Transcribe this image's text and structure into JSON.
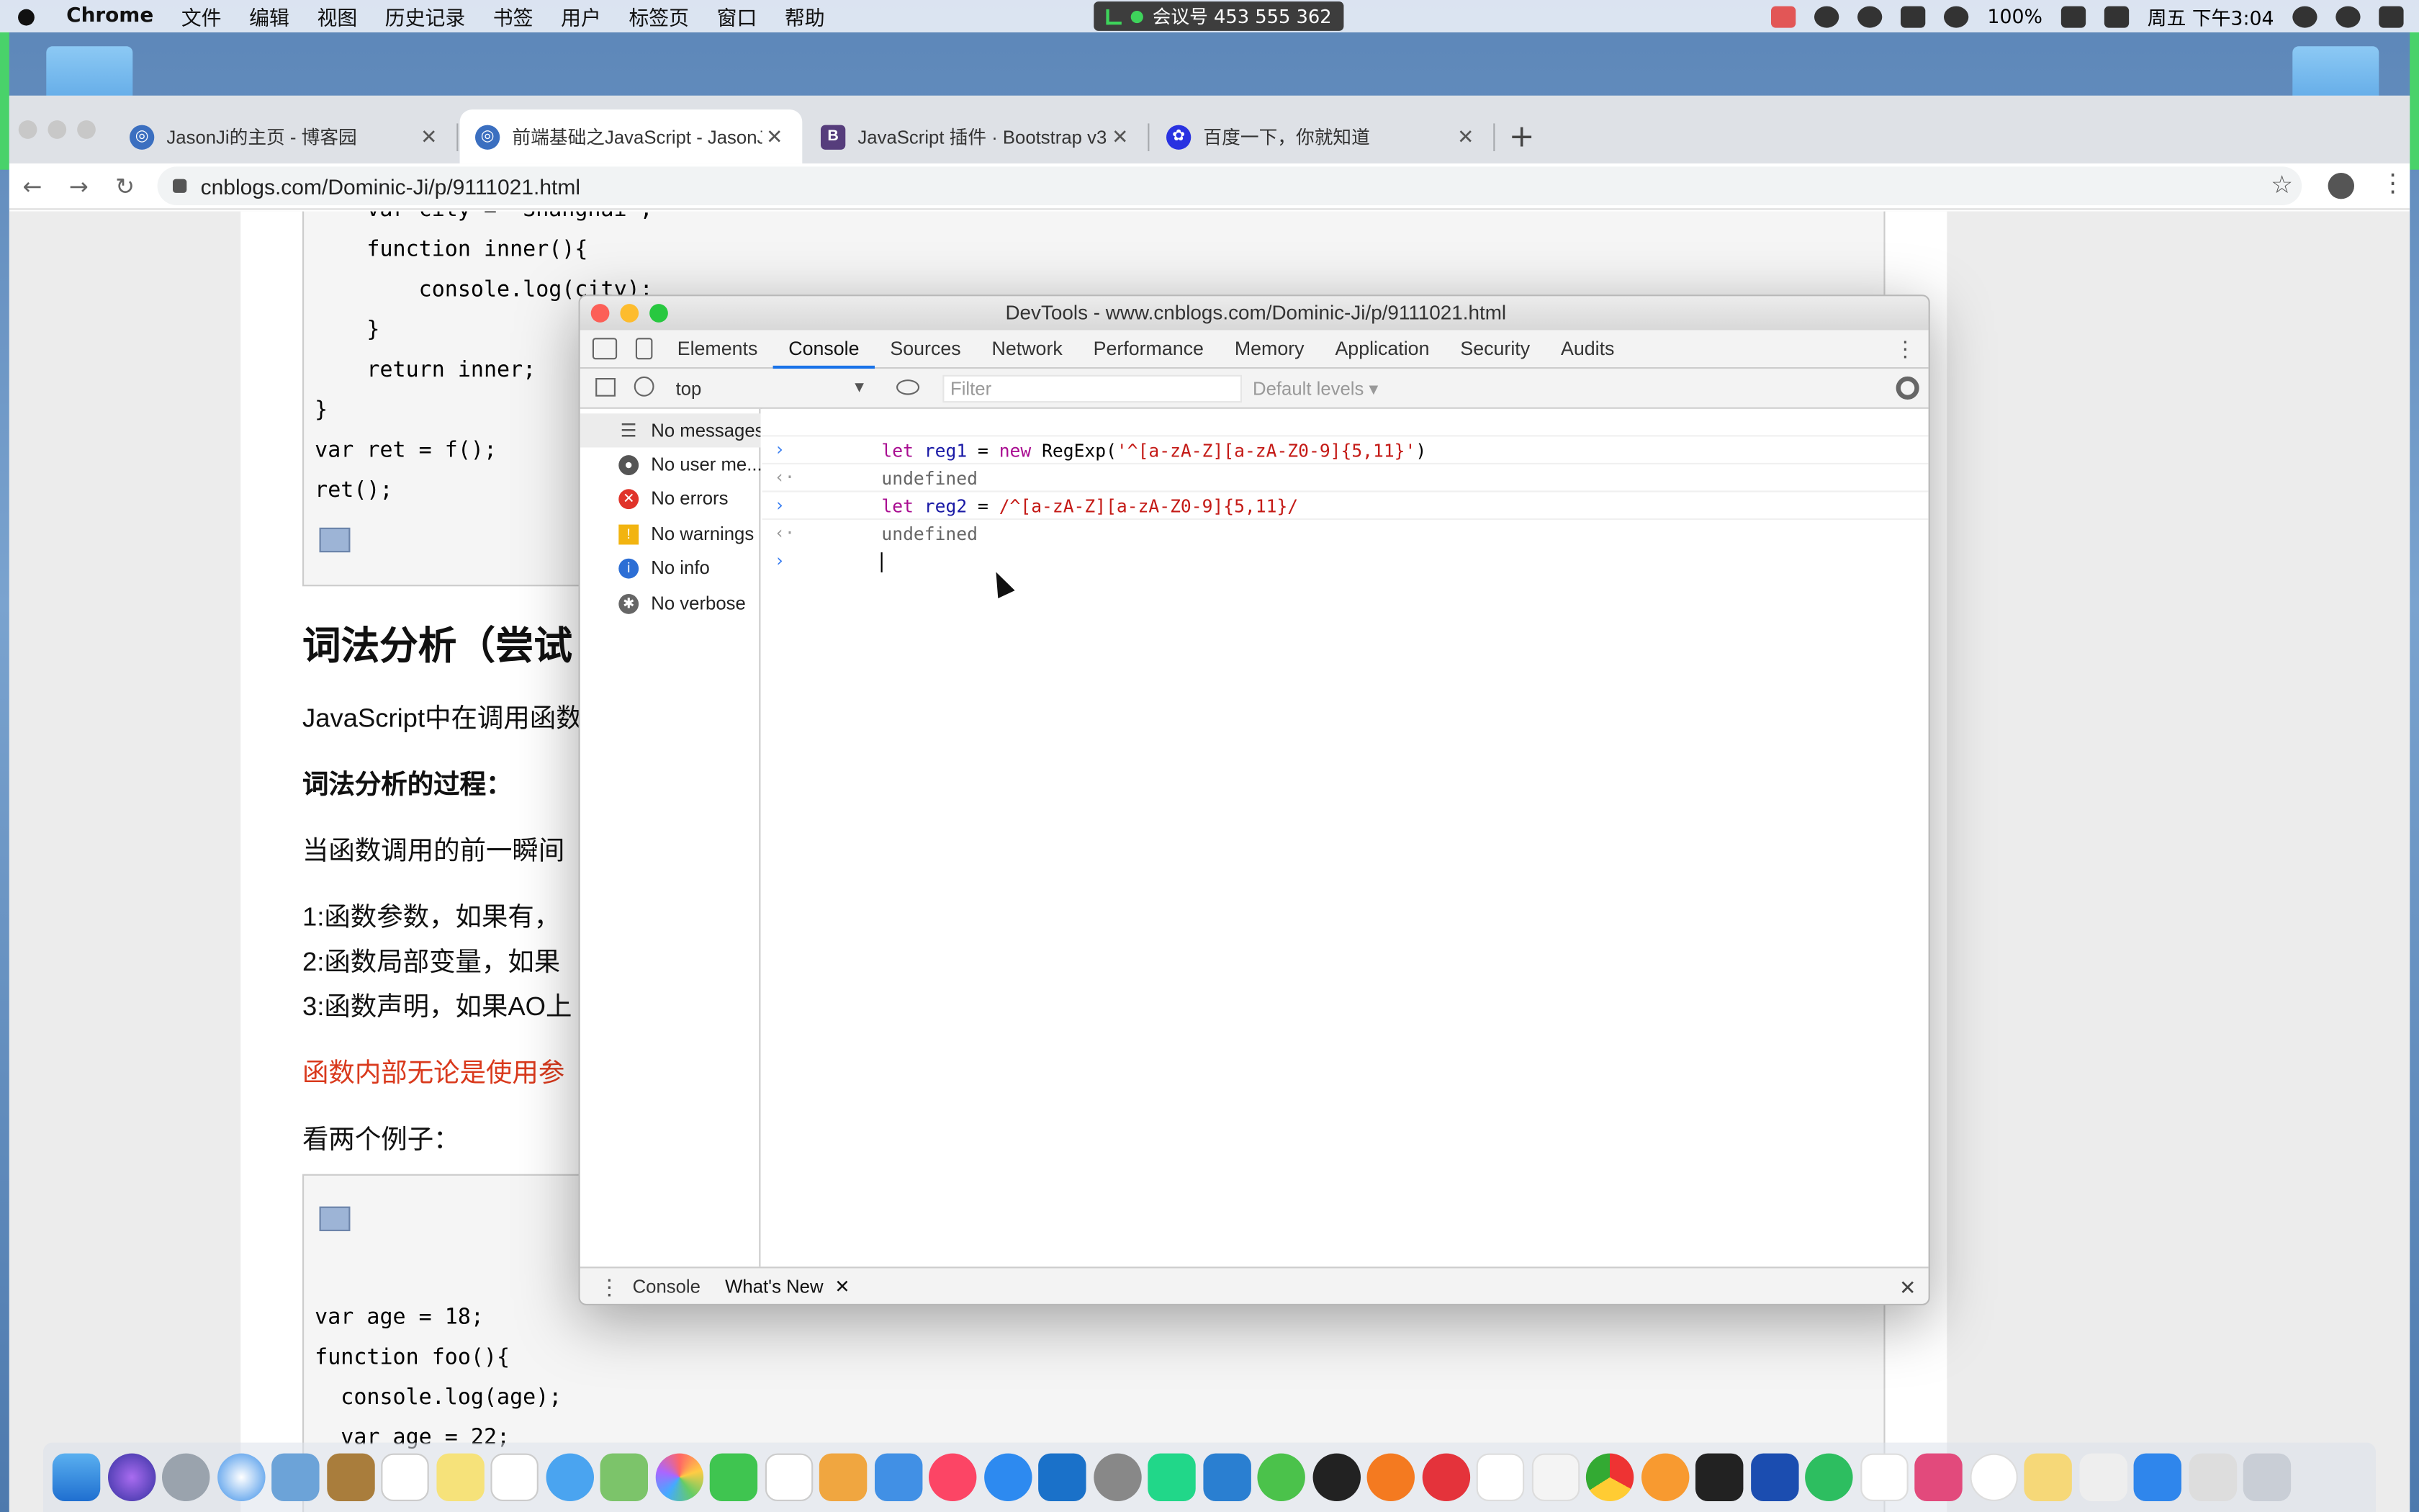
{
  "menubar": {
    "app": "Chrome",
    "menus": [
      "文件",
      "编辑",
      "视图",
      "历史记录",
      "书签",
      "用户",
      "标签页",
      "窗口",
      "帮助"
    ],
    "meeting": "会议号 453 555 362",
    "battery": "100%",
    "datetime": "周五 下午3:04"
  },
  "tabs": [
    {
      "title": "JasonJi的主页 - 博客园",
      "active": false
    },
    {
      "title": "前端基础之JavaScript - JasonJi",
      "active": true
    },
    {
      "title": "JavaScript 插件 · Bootstrap v3",
      "active": false
    },
    {
      "title": "百度一下，你就知道",
      "active": false
    }
  ],
  "url": "cnblogs.com/Dominic-Ji/p/9111021.html",
  "article": {
    "code1": [
      "    var city = 'Shanghai';",
      "    function inner(){",
      "        console.log(city);",
      "    }",
      "    return inner;",
      "}",
      "var ret = f();",
      "ret();"
    ],
    "heading": "词法分析（尝试",
    "p1": "JavaScript中在调用函数",
    "p2": "词法分析的过程：",
    "p3": "当函数调用的前一瞬间",
    "l1": "1:函数参数，如果有，",
    "l2": "2:函数局部变量，如果",
    "l3": "3:函数声明，如果AO上",
    "red": "函数内部无论是使用参",
    "p4": "看两个例子：",
    "code2": [
      "var age = 18;",
      "function foo(){",
      "  console.log(age);",
      "  var age = 22;"
    ]
  },
  "devtools": {
    "title": "DevTools - www.cnblogs.com/Dominic-Ji/p/9111021.html",
    "tabs": [
      "Elements",
      "Console",
      "Sources",
      "Network",
      "Performance",
      "Memory",
      "Application",
      "Security",
      "Audits"
    ],
    "context": "top",
    "filter_placeholder": "Filter",
    "levels": "Default levels ▾",
    "sidebar": [
      "No messages",
      "No user me...",
      "No errors",
      "No warnings",
      "No info",
      "No verbose"
    ],
    "console": {
      "in1_kw": "let",
      "in1_var": "reg1",
      "in1_op": " = ",
      "in1_new": "new",
      "in1_rest": " RegExp(",
      "in1_str": "'^[a-zA-Z][a-zA-Z0-9]{5,11}'",
      "in1_close": ")",
      "out": "undefined",
      "in2_kw": "let",
      "in2_var": "reg2",
      "in2_op": " = ",
      "in2_str": "/^[a-zA-Z][a-zA-Z0-9]{5,11}/"
    },
    "drawer": [
      "Console",
      "What's New"
    ]
  },
  "colors": {
    "accent": "#1a73e8",
    "green": "#49d26a"
  }
}
